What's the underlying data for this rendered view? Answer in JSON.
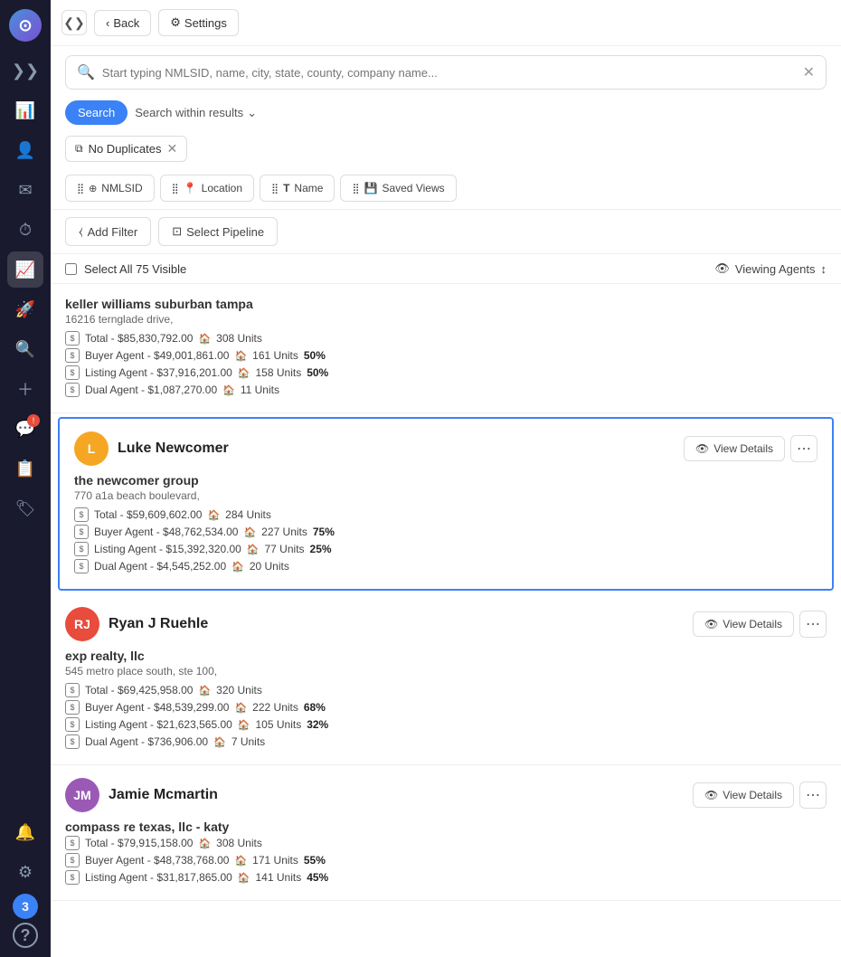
{
  "sidebar": {
    "items": [
      {
        "name": "dashboard-icon",
        "icon": "⊞",
        "active": false
      },
      {
        "name": "contacts-icon",
        "icon": "👤",
        "active": false
      },
      {
        "name": "inbox-icon",
        "icon": "✉",
        "active": false
      },
      {
        "name": "clock-icon",
        "icon": "⏱",
        "active": false
      },
      {
        "name": "chart-icon",
        "icon": "📊",
        "active": true
      },
      {
        "name": "rocket-icon",
        "icon": "🚀",
        "active": false
      },
      {
        "name": "search-icon",
        "icon": "🔍",
        "active": false
      },
      {
        "name": "plus-icon",
        "icon": "＋",
        "active": false
      },
      {
        "name": "chat-icon",
        "icon": "💬",
        "active": false,
        "badge": null
      },
      {
        "name": "doc-icon",
        "icon": "📋",
        "active": false
      },
      {
        "name": "tag-icon",
        "icon": "🏷",
        "active": false
      },
      {
        "name": "bell-icon",
        "icon": "🔔",
        "active": false
      },
      {
        "name": "gear-icon",
        "icon": "⚙",
        "active": false
      },
      {
        "name": "badge-3",
        "icon": "3",
        "badge": true
      },
      {
        "name": "help-icon",
        "icon": "?",
        "active": false
      }
    ]
  },
  "topbar": {
    "collapse_label": "❮❯",
    "back_label": "Back",
    "settings_label": "Settings"
  },
  "search": {
    "placeholder": "Start typing NMLSID, name, city, state, county, company name..."
  },
  "tabs": {
    "search_label": "Search",
    "search_within_label": "Search within results"
  },
  "filters": {
    "no_duplicates_label": "No Duplicates"
  },
  "col_tabs": [
    {
      "icon": "⊕",
      "label": "NMLSID"
    },
    {
      "icon": "📍",
      "label": "Location"
    },
    {
      "icon": "T",
      "label": "Name"
    },
    {
      "icon": "💾",
      "label": "Saved Views"
    }
  ],
  "actions": {
    "add_filter_label": "Add Filter",
    "select_pipeline_label": "Select Pipeline"
  },
  "select_row": {
    "checkbox_label": "Select All 75 Visible",
    "viewing_label": "Viewing Agents"
  },
  "agents": [
    {
      "id": "kw",
      "name": null,
      "avatar_initials": null,
      "avatar_color": null,
      "company": "keller williams suburban tampa",
      "address": "16216 ternglade drive,",
      "stats": [
        {
          "label": "Total - $85,830,792.00",
          "units": "308 Units",
          "pct": null
        },
        {
          "label": "Buyer Agent - $49,001,861.00",
          "units": "161 Units",
          "pct": "50%"
        },
        {
          "label": "Listing Agent - $37,916,201.00",
          "units": "158 Units",
          "pct": "50%"
        },
        {
          "label": "Dual Agent - $1,087,270.00",
          "units": "11 Units",
          "pct": null
        }
      ],
      "highlighted": false,
      "show_header": false
    },
    {
      "id": "luke",
      "name": "Luke Newcomer",
      "avatar_initials": "L",
      "avatar_color": "#f5a623",
      "company": "the newcomer group",
      "address": "770 a1a beach boulevard,",
      "stats": [
        {
          "label": "Total - $59,609,602.00",
          "units": "284 Units",
          "pct": null
        },
        {
          "label": "Buyer Agent - $48,762,534.00",
          "units": "227 Units",
          "pct": "75%"
        },
        {
          "label": "Listing Agent - $15,392,320.00",
          "units": "77 Units",
          "pct": "25%"
        },
        {
          "label": "Dual Agent - $4,545,252.00",
          "units": "20 Units",
          "pct": null
        }
      ],
      "highlighted": true,
      "show_header": true,
      "view_details_label": "View Details"
    },
    {
      "id": "ryan",
      "name": "Ryan J Ruehle",
      "avatar_initials": "RJ",
      "avatar_color": "#e74c3c",
      "company": "exp realty, llc",
      "address": "545 metro place south, ste 100,",
      "stats": [
        {
          "label": "Total - $69,425,958.00",
          "units": "320 Units",
          "pct": null
        },
        {
          "label": "Buyer Agent - $48,539,299.00",
          "units": "222 Units",
          "pct": "68%"
        },
        {
          "label": "Listing Agent - $21,623,565.00",
          "units": "105 Units",
          "pct": "32%"
        },
        {
          "label": "Dual Agent - $736,906.00",
          "units": "7 Units",
          "pct": null
        }
      ],
      "highlighted": false,
      "show_header": true,
      "view_details_label": "View Details"
    },
    {
      "id": "jamie",
      "name": "Jamie Mcmartin",
      "avatar_initials": "JM",
      "avatar_color": "#9b59b6",
      "company": "compass re texas, llc - katy",
      "address": "",
      "stats": [
        {
          "label": "Total - $79,915,158.00",
          "units": "308 Units",
          "pct": null
        },
        {
          "label": "Buyer Agent - $48,738,768.00",
          "units": "171 Units",
          "pct": "55%"
        },
        {
          "label": "Listing Agent - $31,817,865.00",
          "units": "141 Units",
          "pct": "45%"
        }
      ],
      "highlighted": false,
      "show_header": true,
      "view_details_label": "View Details"
    }
  ]
}
